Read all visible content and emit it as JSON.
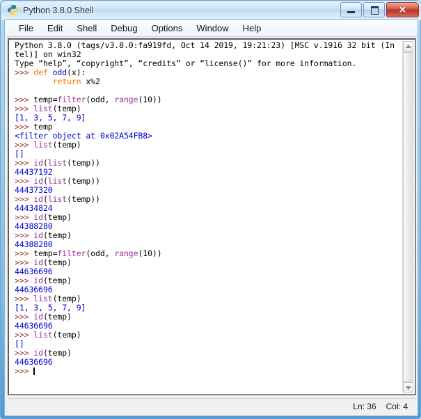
{
  "window": {
    "title": "Python 3.8.0 Shell",
    "icon": "python-logo-icon",
    "buttons": {
      "minimize": "minimize",
      "maximize": "maximize",
      "close": "✕"
    }
  },
  "menubar": {
    "items": [
      {
        "label": "File"
      },
      {
        "label": "Edit"
      },
      {
        "label": "Shell"
      },
      {
        "label": "Debug"
      },
      {
        "label": "Options"
      },
      {
        "label": "Window"
      },
      {
        "label": "Help"
      }
    ]
  },
  "colors": {
    "prompt": "#a0342c",
    "keyword": "#ff7700",
    "definition": "#0000cd",
    "builtin": "#9b30a0",
    "output": "#0000cc",
    "background": "#ffffff",
    "titlebar_accent": "#bcd9f1",
    "close_button": "#b63324"
  },
  "shell": {
    "lines": [
      {
        "id": 1,
        "segments": [
          {
            "t": "Python 3.8.0 (tags/v3.8.0:fa919fd, Oct 14 2019, 19:21:23) [MSC v.1916 32 bit (In",
            "c": "plain"
          }
        ]
      },
      {
        "id": 2,
        "segments": [
          {
            "t": "tel)] on win32",
            "c": "plain"
          }
        ]
      },
      {
        "id": 3,
        "segments": [
          {
            "t": "Type “help”, “copyright”, “credits” or “license()” for more information.",
            "c": "plain"
          }
        ]
      },
      {
        "id": 4,
        "segments": [
          {
            "t": ">>> ",
            "c": "prompt"
          },
          {
            "t": "def ",
            "c": "kw"
          },
          {
            "t": "odd",
            "c": "defname"
          },
          {
            "t": "(x):",
            "c": "plain"
          }
        ]
      },
      {
        "id": 5,
        "segments": [
          {
            "t": "\t",
            "c": "plain"
          },
          {
            "t": "return ",
            "c": "kw"
          },
          {
            "t": "x%2",
            "c": "plain"
          }
        ]
      },
      {
        "id": 6,
        "segments": [
          {
            "t": "",
            "c": "plain"
          }
        ]
      },
      {
        "id": 7,
        "segments": [
          {
            "t": ">>> ",
            "c": "prompt"
          },
          {
            "t": "temp=",
            "c": "plain"
          },
          {
            "t": "filter",
            "c": "builtin"
          },
          {
            "t": "(odd, ",
            "c": "plain"
          },
          {
            "t": "range",
            "c": "builtin"
          },
          {
            "t": "(10))",
            "c": "plain"
          }
        ]
      },
      {
        "id": 8,
        "segments": [
          {
            "t": ">>> ",
            "c": "prompt"
          },
          {
            "t": "list",
            "c": "builtin"
          },
          {
            "t": "(temp)",
            "c": "plain"
          }
        ]
      },
      {
        "id": 9,
        "segments": [
          {
            "t": "[1, 3, 5, 7, 9]",
            "c": "out"
          }
        ]
      },
      {
        "id": 10,
        "segments": [
          {
            "t": ">>> ",
            "c": "prompt"
          },
          {
            "t": "temp",
            "c": "plain"
          }
        ]
      },
      {
        "id": 11,
        "segments": [
          {
            "t": "<filter object at 0x02A54FB8>",
            "c": "out"
          }
        ]
      },
      {
        "id": 12,
        "segments": [
          {
            "t": ">>> ",
            "c": "prompt"
          },
          {
            "t": "list",
            "c": "builtin"
          },
          {
            "t": "(temp)",
            "c": "plain"
          }
        ]
      },
      {
        "id": 13,
        "segments": [
          {
            "t": "[]",
            "c": "out"
          }
        ]
      },
      {
        "id": 14,
        "segments": [
          {
            "t": ">>> ",
            "c": "prompt"
          },
          {
            "t": "id",
            "c": "builtin"
          },
          {
            "t": "(",
            "c": "plain"
          },
          {
            "t": "list",
            "c": "builtin"
          },
          {
            "t": "(temp))",
            "c": "plain"
          }
        ]
      },
      {
        "id": 15,
        "segments": [
          {
            "t": "44437192",
            "c": "out"
          }
        ]
      },
      {
        "id": 16,
        "segments": [
          {
            "t": ">>> ",
            "c": "prompt"
          },
          {
            "t": "id",
            "c": "builtin"
          },
          {
            "t": "(",
            "c": "plain"
          },
          {
            "t": "list",
            "c": "builtin"
          },
          {
            "t": "(temp))",
            "c": "plain"
          }
        ]
      },
      {
        "id": 17,
        "segments": [
          {
            "t": "44437320",
            "c": "out"
          }
        ]
      },
      {
        "id": 18,
        "segments": [
          {
            "t": ">>> ",
            "c": "prompt"
          },
          {
            "t": "id",
            "c": "builtin"
          },
          {
            "t": "(",
            "c": "plain"
          },
          {
            "t": "list",
            "c": "builtin"
          },
          {
            "t": "(temp))",
            "c": "plain"
          }
        ]
      },
      {
        "id": 19,
        "segments": [
          {
            "t": "44434824",
            "c": "out"
          }
        ]
      },
      {
        "id": 20,
        "segments": [
          {
            "t": ">>> ",
            "c": "prompt"
          },
          {
            "t": "id",
            "c": "builtin"
          },
          {
            "t": "(temp)",
            "c": "plain"
          }
        ]
      },
      {
        "id": 21,
        "segments": [
          {
            "t": "44388280",
            "c": "out"
          }
        ]
      },
      {
        "id": 22,
        "segments": [
          {
            "t": ">>> ",
            "c": "prompt"
          },
          {
            "t": "id",
            "c": "builtin"
          },
          {
            "t": "(temp)",
            "c": "plain"
          }
        ]
      },
      {
        "id": 23,
        "segments": [
          {
            "t": "44388280",
            "c": "out"
          }
        ]
      },
      {
        "id": 24,
        "segments": [
          {
            "t": ">>> ",
            "c": "prompt"
          },
          {
            "t": "temp=",
            "c": "plain"
          },
          {
            "t": "filter",
            "c": "builtin"
          },
          {
            "t": "(odd, ",
            "c": "plain"
          },
          {
            "t": "range",
            "c": "builtin"
          },
          {
            "t": "(10))",
            "c": "plain"
          }
        ]
      },
      {
        "id": 25,
        "segments": [
          {
            "t": ">>> ",
            "c": "prompt"
          },
          {
            "t": "id",
            "c": "builtin"
          },
          {
            "t": "(temp)",
            "c": "plain"
          }
        ]
      },
      {
        "id": 26,
        "segments": [
          {
            "t": "44636696",
            "c": "out"
          }
        ]
      },
      {
        "id": 27,
        "segments": [
          {
            "t": ">>> ",
            "c": "prompt"
          },
          {
            "t": "id",
            "c": "builtin"
          },
          {
            "t": "(temp)",
            "c": "plain"
          }
        ]
      },
      {
        "id": 28,
        "segments": [
          {
            "t": "44636696",
            "c": "out"
          }
        ]
      },
      {
        "id": 29,
        "segments": [
          {
            "t": ">>> ",
            "c": "prompt"
          },
          {
            "t": "list",
            "c": "builtin"
          },
          {
            "t": "(temp)",
            "c": "plain"
          }
        ]
      },
      {
        "id": 30,
        "segments": [
          {
            "t": "[1, 3, 5, 7, 9]",
            "c": "out"
          }
        ]
      },
      {
        "id": 31,
        "segments": [
          {
            "t": ">>> ",
            "c": "prompt"
          },
          {
            "t": "id",
            "c": "builtin"
          },
          {
            "t": "(temp)",
            "c": "plain"
          }
        ]
      },
      {
        "id": 32,
        "segments": [
          {
            "t": "44636696",
            "c": "out"
          }
        ]
      },
      {
        "id": 33,
        "segments": [
          {
            "t": ">>> ",
            "c": "prompt"
          },
          {
            "t": "list",
            "c": "builtin"
          },
          {
            "t": "(temp)",
            "c": "plain"
          }
        ]
      },
      {
        "id": 34,
        "segments": [
          {
            "t": "[]",
            "c": "out"
          }
        ]
      },
      {
        "id": 35,
        "segments": [
          {
            "t": ">>> ",
            "c": "prompt"
          },
          {
            "t": "id",
            "c": "builtin"
          },
          {
            "t": "(temp)",
            "c": "plain"
          }
        ]
      },
      {
        "id": 36,
        "segments": [
          {
            "t": "44636696",
            "c": "out"
          }
        ]
      },
      {
        "id": 37,
        "segments": [
          {
            "t": ">>> ",
            "c": "prompt"
          },
          {
            "t": "",
            "c": "caret"
          }
        ]
      }
    ]
  },
  "statusbar": {
    "line_label": "Ln: 36",
    "col_label": "Col: 4"
  },
  "scrollbar": {
    "up_arrow": "scroll-up-arrow",
    "down_arrow": "scroll-down-arrow"
  }
}
